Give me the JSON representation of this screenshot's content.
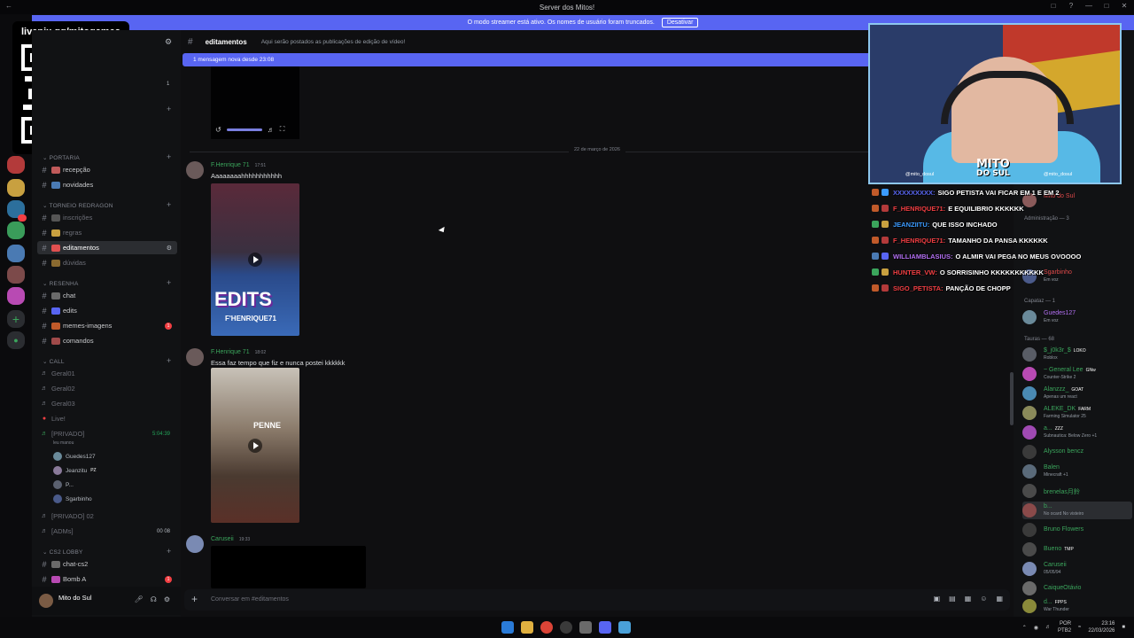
{
  "window": {
    "title": "Server dos Mitos!"
  },
  "banner": {
    "text": "O modo streamer está ativo. Os nomes de usuário foram truncados.",
    "button": "Desativar"
  },
  "overlay": {
    "qr_url": "livepix.gg/mitogames",
    "cam_logo_top": "MITO",
    "cam_logo_bottom": "DO SUL",
    "cam_social_left": "@mito_dosul",
    "cam_social_right": "@mito_dosul"
  },
  "stream_chat": [
    {
      "user": "XXXXXXXXX:",
      "text": "SIGO PETISTA VAI FICAR EM 1 E EM 2",
      "color": "#5865f2"
    },
    {
      "user": "F_HENRIQUE71:",
      "text": "E EQUILIBRIO KKKKKK",
      "color": "#f23f43"
    },
    {
      "user": "JEANZIITU:",
      "text": "QUE ISSO INCHADO",
      "color": "#3b9bff"
    },
    {
      "user": "F_HENRIQUE71:",
      "text": "TAMANHO DA PANSA KKKKKK",
      "color": "#f23f43"
    },
    {
      "user": "WILLIAMBLASIUS:",
      "text": "O ALMIR VAI PEGA NO MEUS OVOOOO",
      "color": "#b16ef0"
    },
    {
      "user": "HUNTER_VW:",
      "text": "O SORRISINHO KKKKKKKKKKK",
      "color": "#f23f43"
    },
    {
      "user": "SIGO_PETISTA:",
      "text": "PANÇÃO DE CHOPP",
      "color": "#f23f43"
    }
  ],
  "sidebar": {
    "categories": {
      "portaria": "PORTARIA",
      "torneio": "TORNEIO REDRAGON",
      "resenha": "RESENHA",
      "call": "CALL",
      "cs2": "CS2 LOBBY"
    },
    "channels": {
      "recepcao": "recepção",
      "novidades": "novidades",
      "inscricoes": "inscrições",
      "regras": "regras",
      "editamentos": "editamentos",
      "duvidas": "dúvidas",
      "chat": "chat",
      "edits": "edits",
      "memes": "memes-imagens",
      "comandos": "comandos",
      "geral01": "Geral01",
      "geral02": "Geral02",
      "geral03": "Geral03",
      "live": "Live!",
      "privado": "[PRIVADO]",
      "privado_time": "5:04:39",
      "privado_sub": "leu manou",
      "privado02": "[PRIVADO] 02",
      "adms": "[ADMs]",
      "adms_count": "00 08",
      "chatcs2": "chat-cs2",
      "bomba": "Bomb A"
    },
    "voice_users": [
      "Guedes127",
      "Jeanzitu",
      "P...",
      "Sgarbinho"
    ],
    "voice_tag": "PZ",
    "badges": {
      "one": "1",
      "unread": "1"
    }
  },
  "user_panel": {
    "name": "Mito do Sul"
  },
  "channel": {
    "name": "editamentos",
    "topic": "Aqui serão postados as publicações de edição de vídeo!",
    "new_messages": "1 mensagem nova desde 23:08",
    "date_divider": "22 de março de 2026"
  },
  "messages": [
    {
      "author": "F.Henrique 71",
      "time": "17:51",
      "text": "Aaaaaaaahhhhhhhhhhh",
      "thumb_text": "EDITS",
      "thumb_sub": "F'HENRIQUE71"
    },
    {
      "author": "F.Henrique 71",
      "time": "18:02",
      "text": "Essa faz tempo que fiz e nunca postei kkkkkk",
      "thumb_text": "PENNE"
    },
    {
      "author": "Caruseii",
      "time": "19:33",
      "text": ""
    }
  ],
  "composer": {
    "placeholder": "Conversar em #editamentos"
  },
  "members": {
    "groups": {
      "capataz": "Capataz — 1",
      "tauras": "Tauras — 68",
      "admin": "Administração — 3"
    },
    "list": [
      {
        "name": "Mito do Sul",
        "status": ""
      },
      {
        "name": "Sgarbinho",
        "status": "Em voz"
      },
      {
        "name": "Guedes127",
        "status": "Em voz"
      },
      {
        "name": "$_j0k3r_$",
        "status": "Roblox",
        "tag": "LOKO"
      },
      {
        "name": "~ General Lee",
        "status": "Counter-Strike 2",
        "tag": "GNw"
      },
      {
        "name": "Alanzzz_",
        "status": "Apenas um react",
        "tag": "GOAT"
      },
      {
        "name": "ALEKE_DK",
        "status": "Farming Simulator 25",
        "tag": "FARM"
      },
      {
        "name": "a...",
        "status": "Subnautica: Below Zero +1",
        "tag": "ZZZ"
      },
      {
        "name": "Alysson bencz",
        "status": ""
      },
      {
        "name": "Balen",
        "status": "Minecraft +1"
      },
      {
        "name": "brenelas月鈴",
        "status": ""
      },
      {
        "name": "b...",
        "status": "No ocard No visteiro"
      },
      {
        "name": "Bruno Flowers",
        "status": ""
      },
      {
        "name": "Bueno",
        "status": "",
        "tag": "TMP"
      },
      {
        "name": "Caruseii",
        "status": "05/05/94"
      },
      {
        "name": "CaiqueOtávio",
        "status": ""
      },
      {
        "name": "d...",
        "status": "War Thunder",
        "tag": "FPPS"
      }
    ]
  },
  "taskbar": {
    "lang": "POR",
    "lang2": "PTB2",
    "time": "23:16",
    "date": "22/03/2026"
  }
}
